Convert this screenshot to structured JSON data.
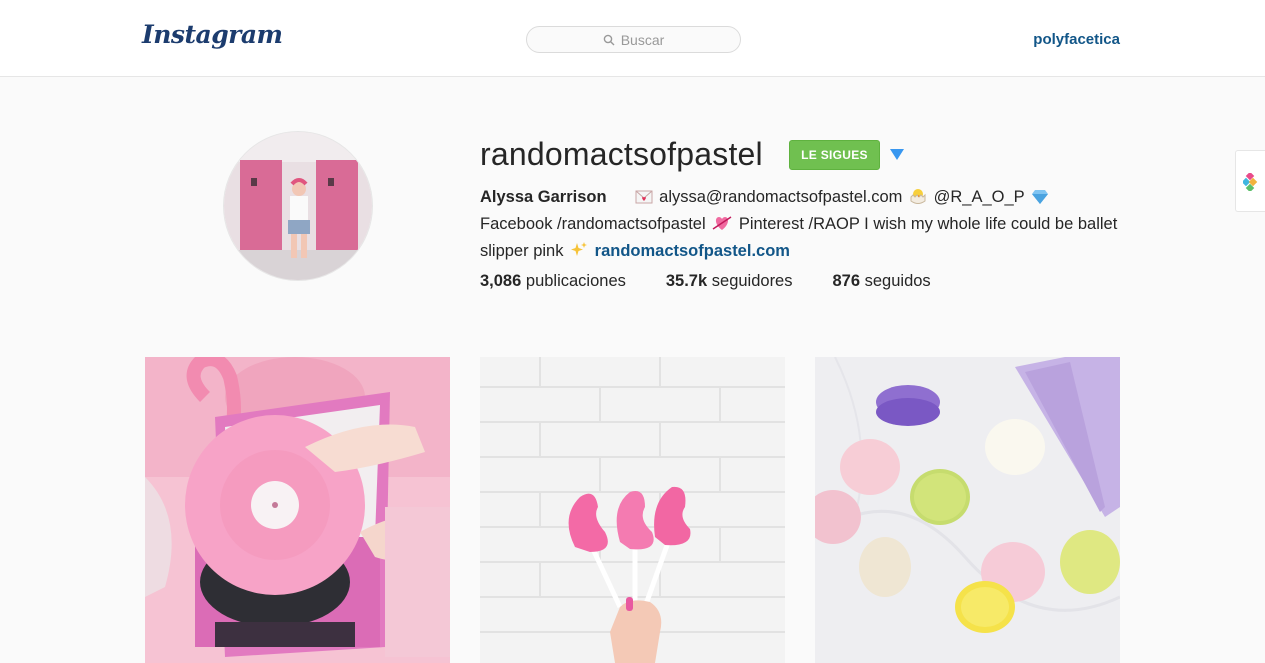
{
  "header": {
    "logo_text": "Instagram",
    "search_placeholder": "Buscar",
    "current_user": "polyfacetica"
  },
  "profile": {
    "username": "randomactsofpastel",
    "follow_button_label": "LE SIGUES",
    "full_name": "Alyssa Garrison",
    "bio_email": "alyssa@randomactsofpastel.com",
    "bio_handle": "@R_A_O_P",
    "bio_part_facebook": "Facebook /randomactsofpastel",
    "bio_part_text": "Pinterest /RAOP I wish my whole life could be ballet slipper pink",
    "website": "randomactsofpastel.com",
    "stats": {
      "posts_count": "3,086",
      "posts_label": "publicaciones",
      "followers_count": "35.7k",
      "followers_label": "seguidores",
      "following_count": "876",
      "following_label": "seguidos"
    }
  },
  "posts": [
    {
      "subject": "pink record player with flamingo"
    },
    {
      "subject": "pink flamingo lollipops against white brick wall"
    },
    {
      "subject": "pastel macarons on marble"
    }
  ],
  "colors": {
    "follow_green": "#70c050",
    "link_blue": "#125688",
    "arrow_blue": "#3897f0",
    "logo_navy": "#1c3c6e"
  },
  "icons": [
    "search-icon",
    "love-letter-icon",
    "hatching-chick-icon",
    "gem-icon",
    "heart-arrow-icon",
    "sparkles-icon",
    "chevron-down-icon",
    "extension-icon"
  ]
}
